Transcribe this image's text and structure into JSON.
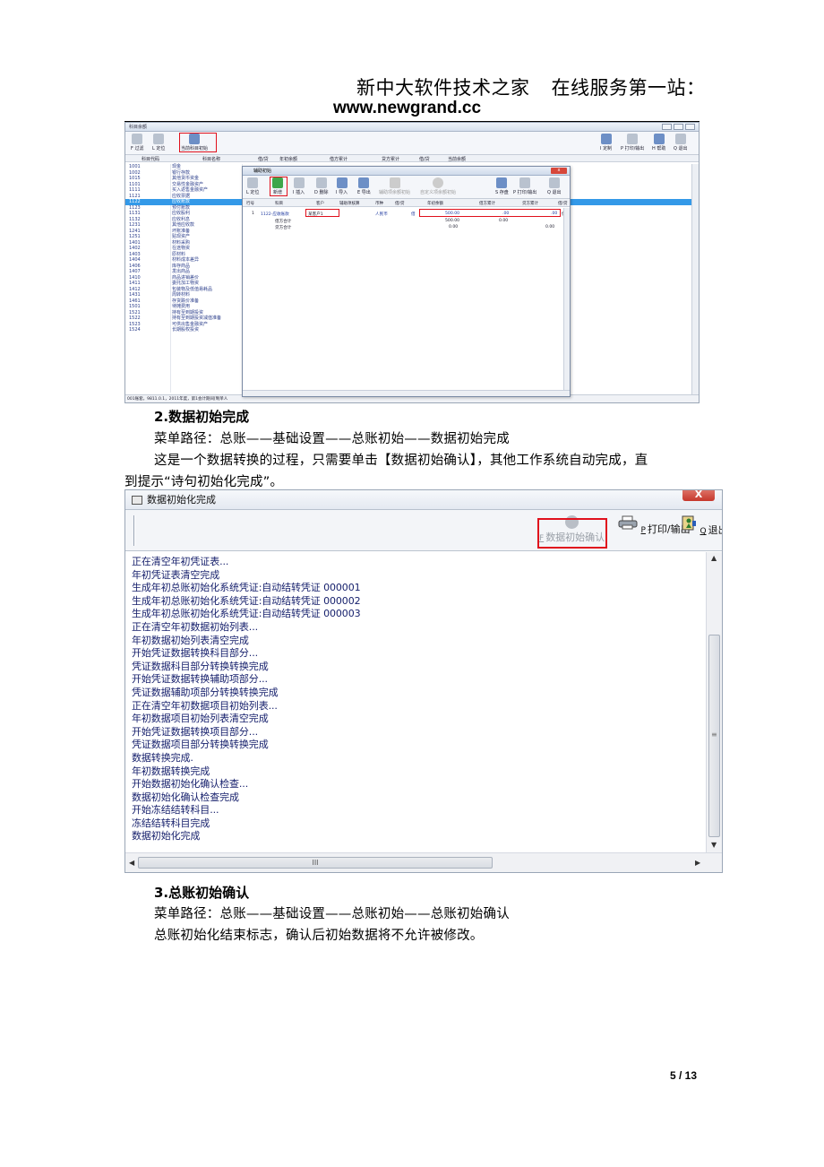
{
  "header": {
    "company": "新中大软件技术之家",
    "tagline": "在线服务第一站：",
    "website": "www.newgrand.cc"
  },
  "screenshot1": {
    "window_title": "科目余额",
    "toolbar_left": [
      {
        "key": "F",
        "label": "过滤"
      },
      {
        "key": "L",
        "label": "定位"
      },
      {
        "label": "当前科目初始"
      }
    ],
    "toolbar_right": [
      {
        "key": "I",
        "label": "定制"
      },
      {
        "key": "P",
        "label": "打印/输出"
      },
      {
        "key": "H",
        "label": "帮助"
      },
      {
        "key": "Q",
        "label": "退出"
      }
    ],
    "columns": [
      "科目代码",
      "科目名称",
      "借/贷",
      "年初余额",
      "借方累计",
      "贷方累计",
      "借/贷",
      "当前余额"
    ],
    "accounts": [
      {
        "code": "1001",
        "name": "现金"
      },
      {
        "code": "1002",
        "name": "银行存款"
      },
      {
        "code": "1015",
        "name": "其他货币资金"
      },
      {
        "code": "1101",
        "name": "交易性金融资产"
      },
      {
        "code": "1111",
        "name": "买入返售金融资产"
      },
      {
        "code": "1121",
        "name": "应收票据"
      },
      {
        "code": "1122",
        "name": "应收账款",
        "selected": true
      },
      {
        "code": "1123",
        "name": "预付账款"
      },
      {
        "code": "1131",
        "name": "应收股利"
      },
      {
        "code": "1132",
        "name": "应收利息"
      },
      {
        "code": "1231",
        "name": "其他应收款"
      },
      {
        "code": "1241",
        "name": "坏账准备"
      },
      {
        "code": "1251",
        "name": "贴现资产"
      },
      {
        "code": "1401",
        "name": "材料采购"
      },
      {
        "code": "1402",
        "name": "在途物资"
      },
      {
        "code": "1403",
        "name": "原材料"
      },
      {
        "code": "1404",
        "name": "材料成本差异"
      },
      {
        "code": "1406",
        "name": "库存商品"
      },
      {
        "code": "1407",
        "name": "发出商品"
      },
      {
        "code": "1410",
        "name": "商品进销差价"
      },
      {
        "code": "1411",
        "name": "委托加工物资"
      },
      {
        "code": "1412",
        "name": "包装物及低值易耗品"
      },
      {
        "code": "1431",
        "name": "周转材料"
      },
      {
        "code": "1461",
        "name": "存货跌价准备"
      },
      {
        "code": "1501",
        "name": "待摊费用"
      },
      {
        "code": "1521",
        "name": "持有至到期投资"
      },
      {
        "code": "1522",
        "name": "持有至到期投资减值准备"
      },
      {
        "code": "1523",
        "name": "可供出售金融资产"
      },
      {
        "code": "1524",
        "name": "长期股权投资"
      }
    ],
    "status_bar": "001账套，9811.0.1，2011年度，第1会计期间[制单人",
    "dialog": {
      "title": "辅助初始",
      "buttons": [
        {
          "key": "L",
          "label": "定位"
        },
        {
          "label": "新增"
        },
        {
          "key": "I",
          "label": "插入"
        },
        {
          "key": "D",
          "label": "删除"
        },
        {
          "key": "I",
          "label": "导入"
        },
        {
          "key": "E",
          "label": "导出"
        },
        {
          "label": "辅助项余额初始"
        },
        {
          "label": "自定义项余额初始"
        },
        {
          "key": "S",
          "label": "存盘"
        },
        {
          "key": "P",
          "label": "打印/输出"
        },
        {
          "key": "Q",
          "label": "退出"
        }
      ],
      "columns": [
        "行号",
        "科目",
        "客户",
        "辅助项核算",
        "币种",
        "借/贷",
        "年初余额",
        "借方累计",
        "贷方累计",
        "借/贷"
      ],
      "row": {
        "no": "1",
        "account": "1122-应收账款",
        "customer": "某客户1",
        "currency": "人民币",
        "dc": "借",
        "opening": "500.00",
        "debit": ".00",
        "credit": ".00",
        "dc2": "借"
      },
      "debit_total": {
        "label": "借方合计",
        "opening": "500.00",
        "debit": "0.00"
      },
      "credit_total": {
        "label": "贷方合计",
        "opening": "0.00",
        "credit": "0.00"
      }
    }
  },
  "section2": {
    "title": "2.数据初始完成",
    "menu_path": "菜单路径：总账——基础设置——总账初始——数据初始完成",
    "desc_line1": "这是一个数据转换的过程，只需要单击【数据初始确认】，其他工作系统自动完成，直",
    "desc_line2": "到提示“诗句初始化完成”。"
  },
  "screenshot2": {
    "window_title": "数据初始化完成",
    "close_label": "X",
    "buttons": [
      {
        "key": "F",
        "label": "数据初始确认",
        "disabled": true
      },
      {
        "key": "P",
        "label": "打印/输出"
      },
      {
        "key": "Q",
        "label": "退出"
      }
    ],
    "log": [
      "正在清空年初凭证表...",
      "年初凭证表清空完成",
      "生成年初总账初始化系统凭证:自动结转凭证 000001",
      "生成年初总账初始化系统凭证:自动结转凭证 000002",
      "生成年初总账初始化系统凭证:自动结转凭证 000003",
      "正在清空年初数据初始列表...",
      "年初数据初始列表清空完成",
      "开始凭证数据转换科目部分...",
      "凭证数据科目部分转换转换完成",
      "开始凭证数据转换辅助项部分...",
      "凭证数据辅助项部分转换转换完成",
      "正在清空年初数据项目初始列表...",
      "年初数据项目初始列表清空完成",
      "开始凭证数据转换项目部分...",
      "凭证数据项目部分转换转换完成",
      "数据转换完成.",
      "年初数据转换完成",
      "开始数据初始化确认检查...",
      "数据初始化确认检查完成",
      "开始冻结结转科目...",
      "冻结结转科目完成",
      "数据初始化完成"
    ],
    "hscroll_grip": "III"
  },
  "section3": {
    "title": "3.总账初始确认",
    "menu_path": "菜单路径：总账——基础设置——总账初始——总账初始确认",
    "desc": "总账初始化结束标志，确认后初始数据将不允许被修改。"
  },
  "page_number": "5 / 13",
  "colors": {
    "highlight_red": "#e0101c",
    "selected_row": "#3399e8",
    "log_text": "#141e6b"
  }
}
